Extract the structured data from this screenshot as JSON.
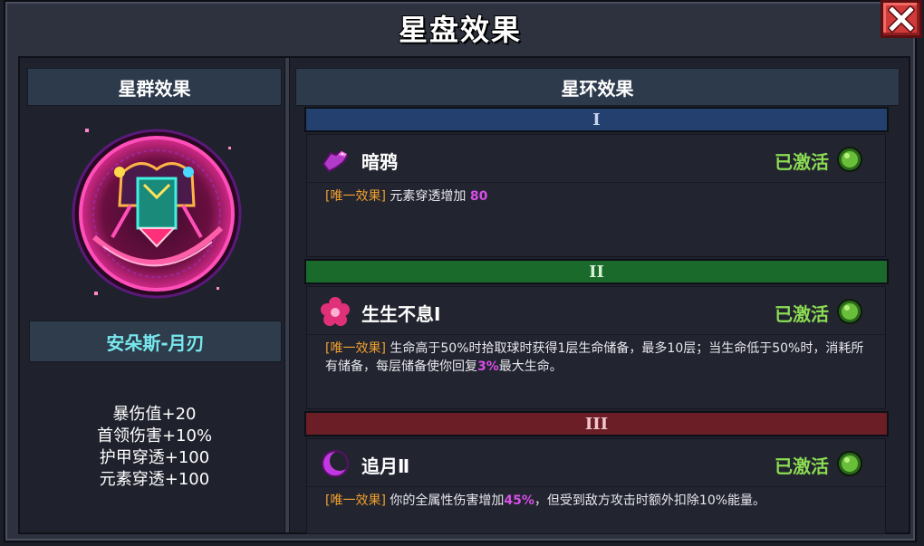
{
  "window": {
    "title": "星盘效果",
    "close_icon": "close-x-icon"
  },
  "left_panel": {
    "header": "星群效果",
    "constellation_name": "安朵斯-月刃",
    "stats": [
      "暴伤值+20",
      "首领伤害+10%",
      "护甲穿透+100",
      "元素穿透+100"
    ]
  },
  "right_panel": {
    "header": "星环效果",
    "tiers": [
      {
        "numeral": "I",
        "color": "#23406e",
        "effect": {
          "name": "暗鸦",
          "icon": "crow-icon",
          "status": "已激活",
          "tag": "[唯一效果]",
          "desc_parts": [
            {
              "text": " 元素穿透增加 ",
              "hl": false
            },
            {
              "text": "80",
              "hl": true
            }
          ]
        }
      },
      {
        "numeral": "II",
        "color": "#1a6a2b",
        "effect": {
          "name": "生生不息Ⅰ",
          "icon": "flower-icon",
          "status": "已激活",
          "tag": "[唯一效果]",
          "desc_parts": [
            {
              "text": " 生命高于50%时拾取球时获得1层生命储备，最多10层；当生命低于50%时，消耗所有储备，每层储备使你回复",
              "hl": false
            },
            {
              "text": "3%",
              "hl": true
            },
            {
              "text": "最大生命。",
              "hl": false
            }
          ]
        }
      },
      {
        "numeral": "III",
        "color": "#6b1e26",
        "effect": {
          "name": "追月Ⅱ",
          "icon": "crescent-moon-icon",
          "status": "已激活",
          "tag": "[唯一效果]",
          "desc_parts": [
            {
              "text": " 你的全属性伤害增加",
              "hl": false
            },
            {
              "text": "45%",
              "hl": true
            },
            {
              "text": "，但受到敌方攻击时额外扣除10%能量。",
              "hl": false
            }
          ]
        }
      }
    ]
  },
  "colors": {
    "active_status": "#8bdb52",
    "highlight": "#d84ee8",
    "tag": "#f0a030",
    "name_plate_text": "#78e8ee"
  }
}
